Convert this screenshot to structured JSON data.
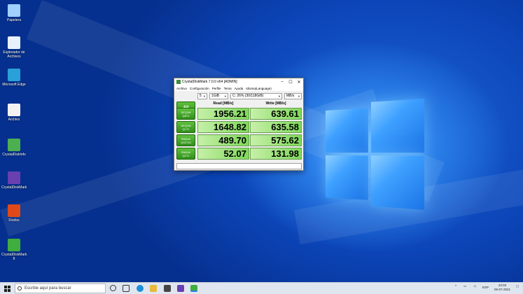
{
  "desktop_icons": [
    {
      "label": "Papelera",
      "icon": "recycle-bin-icon",
      "color": "#9fd0ff"
    },
    {
      "label": "Explorador de Archivos",
      "icon": "file-explorer-icon",
      "color": "#e8f2ff"
    },
    {
      "label": "Microsoft Edge",
      "icon": "edge-icon",
      "color": "#2aa0d8"
    },
    {
      "label": "Archivo",
      "icon": "document-icon",
      "color": "#f2f2f2"
    },
    {
      "label": "CrystalDiskInfo",
      "icon": "app-icon",
      "color": "#4caf50"
    },
    {
      "label": "CrystalDiskMark",
      "icon": "app-icon",
      "color": "#6a3fb0"
    },
    {
      "label": "Firefox",
      "icon": "firefox-icon",
      "color": "#e04a1a"
    },
    {
      "label": "CrystalDiskMark 8",
      "icon": "app-icon",
      "color": "#3fae3f"
    }
  ],
  "window": {
    "title": "CrystalDiskMark 7.0.0 x64 [ADMIN]",
    "minimize": "–",
    "maximize": "☐",
    "close": "✕",
    "menu": [
      "Archivo",
      "Configuración",
      "Perfile",
      "Tema",
      "Ayuda",
      "Idioma(Language)"
    ],
    "controls": {
      "count": "5",
      "size": "1GiB",
      "drive": "C: 26% (30/118GiB)",
      "unit": "MB/s"
    },
    "all_label": "All",
    "read_header": "Read [MB/s]",
    "write_header": "Write [MB/s]",
    "tests": [
      {
        "line1": "SEQ1M",
        "line2": "Q8T1",
        "read": "1956.21",
        "write": "639.61"
      },
      {
        "line1": "SEQ1M",
        "line2": "Q1T1",
        "read": "1648.82",
        "write": "635.58"
      },
      {
        "line1": "RND4K",
        "line2": "Q32T16",
        "read": "489.70",
        "write": "575.62"
      },
      {
        "line1": "RND4K",
        "line2": "Q1T1",
        "read": "52.07",
        "write": "131.98"
      }
    ]
  },
  "taskbar": {
    "search_placeholder": "Escribe aquí para buscar",
    "language": "ESP",
    "time": "23:03",
    "date": "06-07-2021"
  }
}
